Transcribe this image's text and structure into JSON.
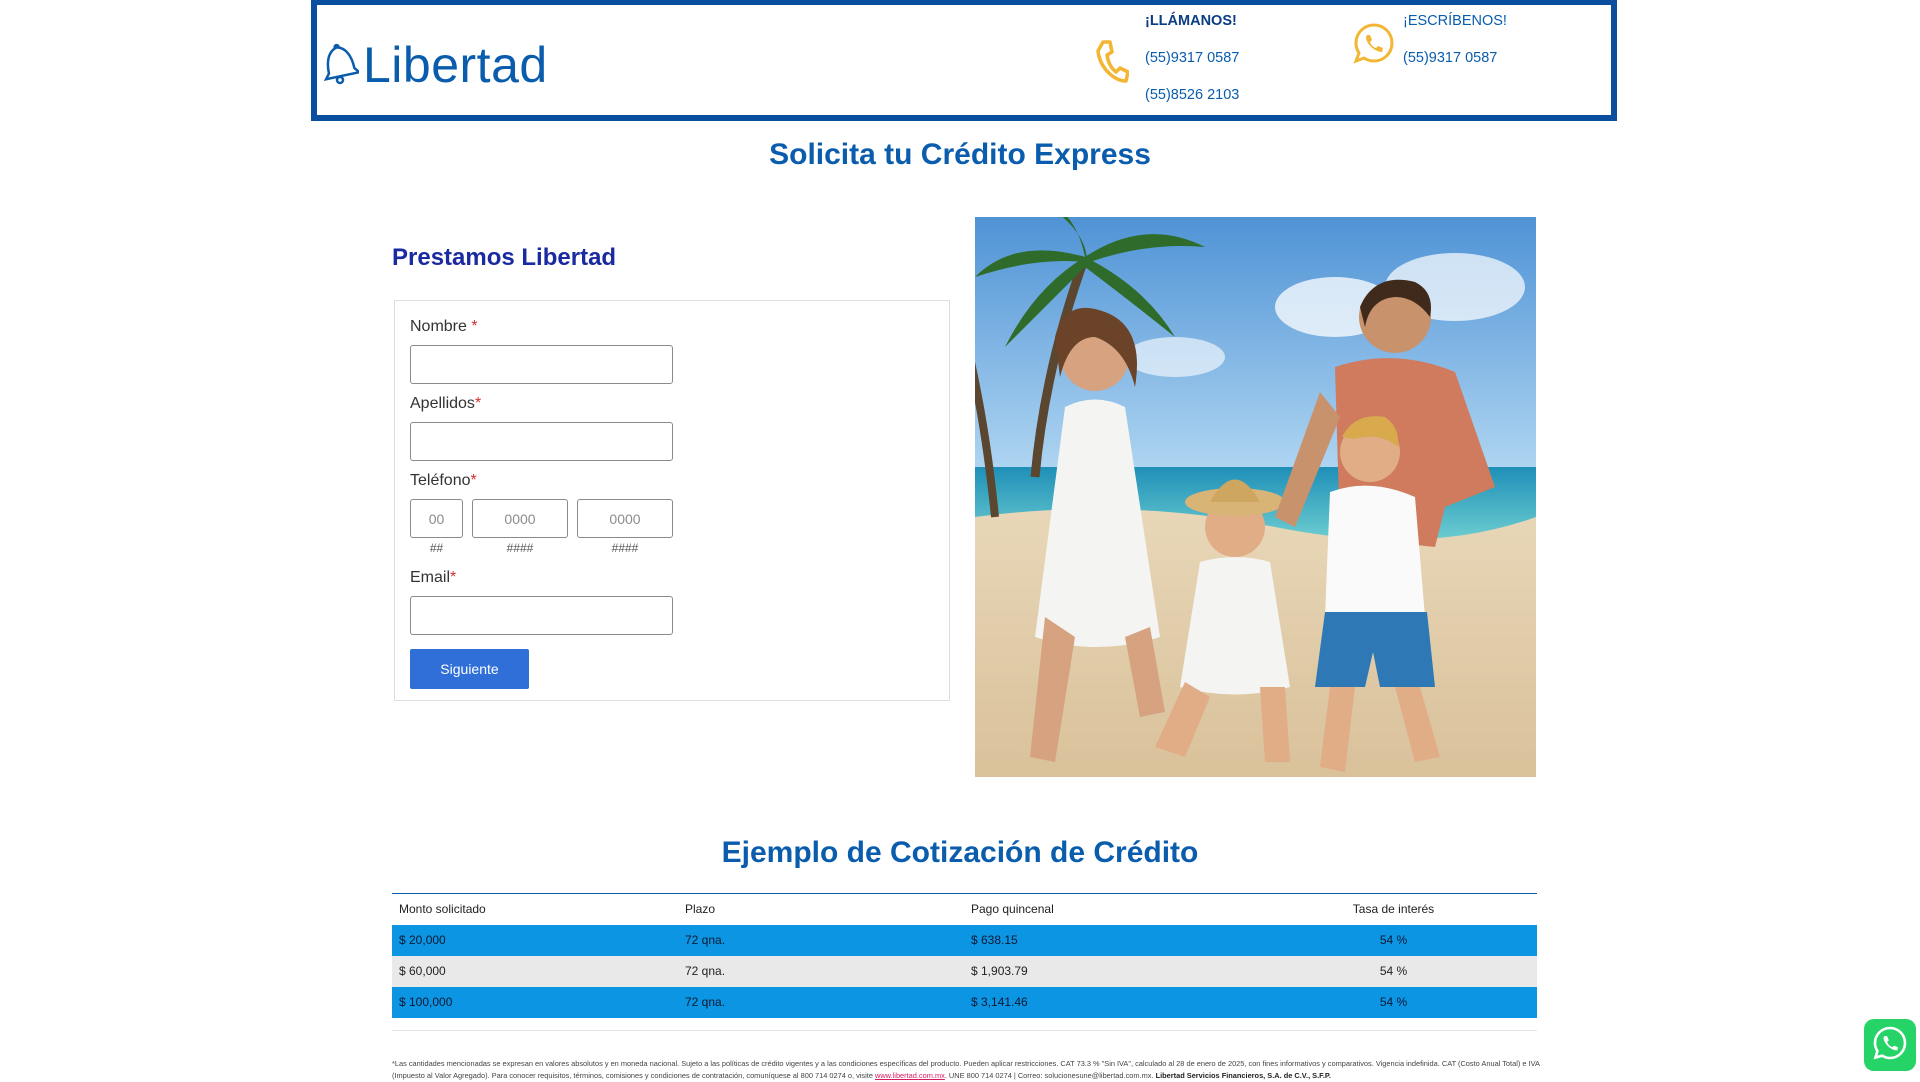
{
  "colors": {
    "brand_blue": "#0a5cad",
    "header_border": "#0a4ea0",
    "icon_gold": "#f2b632",
    "row_blue": "#0b95e3",
    "button_blue": "#2f6fd7",
    "required_red": "#d32f2f"
  },
  "header": {
    "logo_text": "Libertad",
    "logo_icon": "bell-icon",
    "call": {
      "icon": "phone-icon",
      "title": "¡LLÁMANOS!",
      "numbers": [
        "(55)9317 0587",
        "(55)8526 2103"
      ]
    },
    "write": {
      "icon": "whatsapp-icon",
      "title": "¡ESCRÍBENOS!",
      "numbers": [
        "(55)9317 0587"
      ]
    }
  },
  "main": {
    "title": "Solicita tu Crédito Express"
  },
  "form": {
    "title": "Prestamos Libertad",
    "fields": {
      "name": {
        "label": "Nombre ",
        "required_mark": "*",
        "value": ""
      },
      "last_name": {
        "label": "Apellidos",
        "required_mark": "*",
        "value": ""
      },
      "phone": {
        "label": "Teléfono",
        "required_mark": "*",
        "parts": [
          {
            "placeholder": "00",
            "hint": "##"
          },
          {
            "placeholder": "0000",
            "hint": "####"
          },
          {
            "placeholder": "0000",
            "hint": "####"
          }
        ]
      },
      "email": {
        "label": "Email",
        "required_mark": "*",
        "value": ""
      }
    },
    "submit_label": "Siguiente"
  },
  "quote": {
    "title": "Ejemplo de Cotización de Crédito",
    "headers": [
      "Monto solicitado",
      "Plazo",
      "Pago quincenal",
      "Tasa de interés"
    ],
    "rows": [
      [
        "$ 20,000",
        "72 qna.",
        "$ 638.15",
        "54 %"
      ],
      [
        "$ 60,000",
        "72 qna.",
        "$ 1,903.79",
        "54 %"
      ],
      [
        "$ 100,000",
        "72 qna.",
        "$ 3,141.46",
        "54 %"
      ]
    ]
  },
  "disclaimer": {
    "text_1": "*Las cantidades mencionadas se expresan en valores absolutos y en moneda nacional. Sujeto a las políticas de crédito vigentes y a las condiciones específicas del producto. Pueden aplicar restricciones. CAT 73.3 % \"Sin IVA\", calculado al 28 de enero de 2025, con fines informativos y comparativos. Vigencia indefinida. CAT (Costo Anual Total) e IVA (Impuesto al Valor Agregado). Para conocer requisitos, términos, comisiones y condiciones de contratación, comuníquese al 800 714 0274 o, visite ",
    "link_text": "www.libertad.com.mx",
    "text_2": ". UNE 800 714 0274 | Correo: solucionesune@libertad.com.mx. ",
    "company": "Libertad Servicios Financieros, S.A. de C.V., S.F.P."
  },
  "floating": {
    "whatsapp_icon": "whatsapp-icon"
  }
}
